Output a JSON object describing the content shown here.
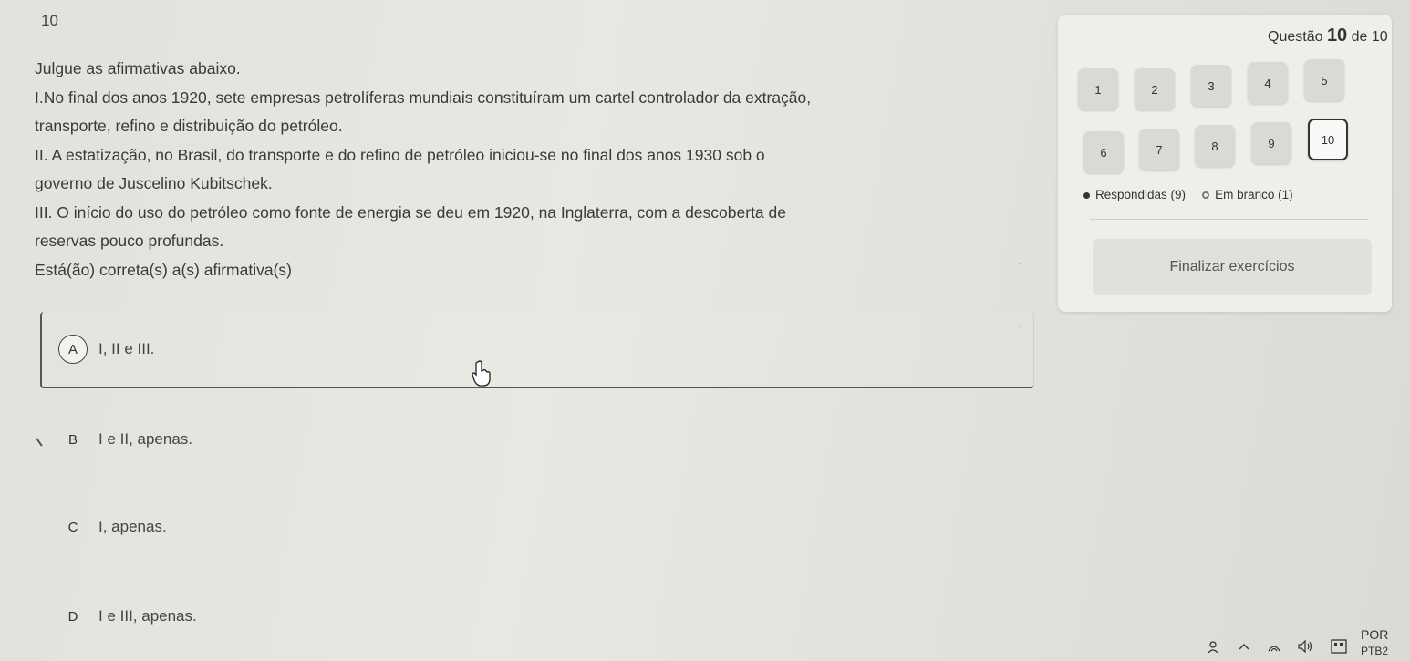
{
  "header": {
    "question_number": "10"
  },
  "question": {
    "lines": [
      "Julgue as afirmativas abaixo.",
      "I.No final dos anos 1920, sete empresas petrolíferas mundiais constituíram um cartel controlador da extração,",
      "transporte, refino e distribuição do petróleo.",
      "II. A estatização, no Brasil, do transporte e do refino de petróleo iniciou-se no final dos anos 1930 sob o",
      "governo de Juscelino Kubitschek.",
      "III. O início do uso do petróleo como fonte de energia se deu em 1920, na Inglaterra, com a descoberta de",
      "reservas pouco profundas.",
      "Está(ão) correta(s) a(s) afirmativa(s)"
    ]
  },
  "options": [
    {
      "letter": "A",
      "text": "I, II e III.",
      "selected": true
    },
    {
      "letter": "B",
      "text": "I e II, apenas.",
      "selected": false
    },
    {
      "letter": "C",
      "text": "I, apenas.",
      "selected": false
    },
    {
      "letter": "D",
      "text": "I e III, apenas.",
      "selected": false
    }
  ],
  "panel": {
    "title_prefix": "Questão",
    "title_current": "10",
    "title_suffix": "de 10",
    "buttons": [
      "1",
      "2",
      "3",
      "4",
      "5",
      "6",
      "7",
      "8",
      "9",
      "10"
    ],
    "current": "10",
    "legend_answered": "Respondidas (9)",
    "legend_blank": "Em branco (1)",
    "finish_label": "Finalizar exercícios"
  },
  "taskbar": {
    "language": "POR",
    "layout": "PTB2"
  },
  "icons": [
    "people-icon",
    "chevron-up-icon",
    "wifi-icon",
    "speaker-icon",
    "keyboard-icon",
    "hand-cursor-icon"
  ]
}
